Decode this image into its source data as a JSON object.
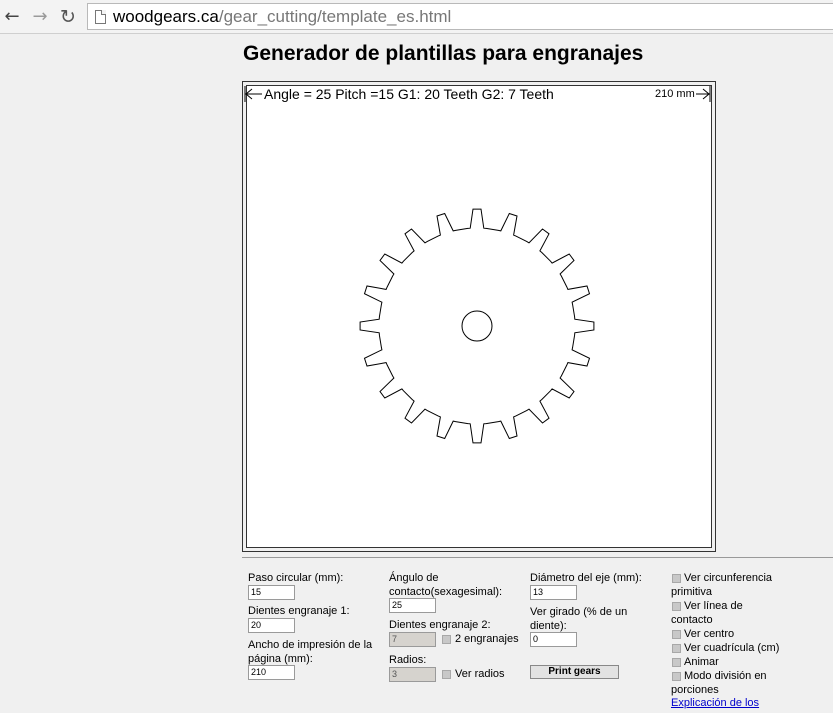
{
  "browser": {
    "back_icon": "←",
    "forward_icon": "→",
    "reload_icon": "↻",
    "url_host": "woodgears.ca",
    "url_path": "/gear_cutting/template_es.html"
  },
  "page": {
    "title": "Generador de plantillas para engranajes",
    "template_info": "Angle = 25   Pitch =15   G1: 20 Teeth   G2: 7 Teeth",
    "width_label": "210 mm"
  },
  "gear": {
    "teeth": 20,
    "pressure_angle_deg": 25,
    "circular_pitch_mm": 15,
    "shaft_diameter_mm": 13
  },
  "form": {
    "circular_pitch_label": "Paso circular (mm):",
    "circular_pitch_value": "15",
    "gear1_teeth_label": "Dientes engranaje 1:",
    "gear1_teeth_value": "20",
    "page_width_label_1": "Ancho de impresión de la",
    "page_width_label_2": "página (mm):",
    "page_width_value": "210",
    "contact_angle_label_1": "Ángulo de",
    "contact_angle_label_2": "contacto(sexagesimal):",
    "contact_angle_value": "25",
    "gear2_teeth_label": "Dientes engranaje 2:",
    "gear2_teeth_value": "7",
    "two_gears_label": "2 engranajes",
    "spokes_label": "Radios:",
    "spokes_value": "3",
    "show_spokes_label": "Ver radios",
    "shaft_diameter_label": "Diámetro del eje (mm):",
    "shaft_diameter_value": "13",
    "rotated_label_1": "Ver girado (% de un",
    "rotated_label_2": "diente):",
    "rotated_value": "0",
    "print_button": "Print gears"
  },
  "options": {
    "pitch_circle_1": "Ver circunferencia",
    "pitch_circle_2": "primitiva",
    "contact_line_1": "Ver línea de",
    "contact_line_2": "contacto",
    "show_center": "Ver centro",
    "show_grid": "Ver cuadrícula (cm)",
    "animate": "Animar",
    "slice_mode_1": "Modo división en",
    "slice_mode_2": "porciones",
    "explanation_link": "Explicación de los"
  },
  "colors": {
    "link": "#0000cc",
    "canvas_bg": "#ffffff",
    "page_bg": "#f0f0f0"
  }
}
